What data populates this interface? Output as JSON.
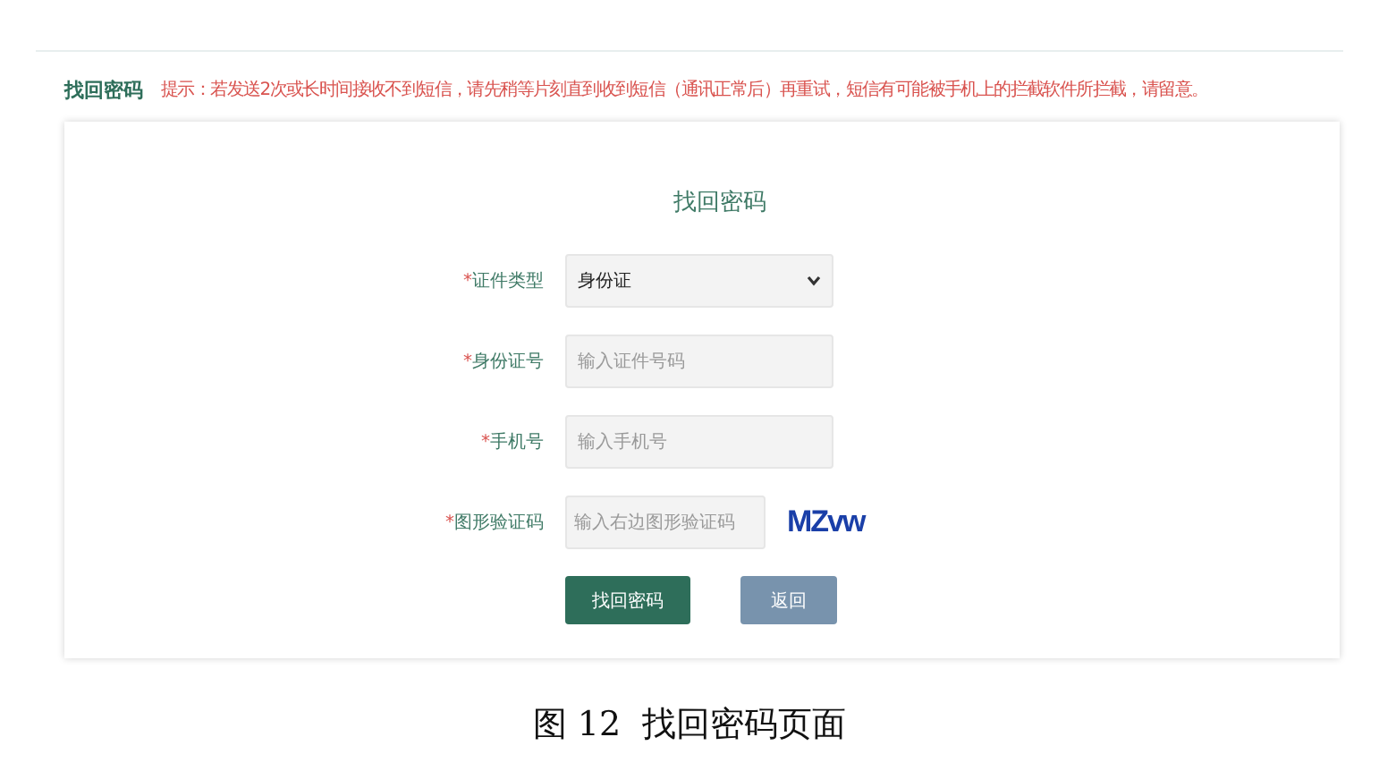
{
  "header": {
    "title": "找回密码",
    "hint": "提示：若发送2次或长时间接收不到短信，请先稍等片刻直到收到短信（通讯正常后）再重试，短信有可能被手机上的拦截软件所拦截，请留意。"
  },
  "form": {
    "title": "找回密码",
    "fields": [
      {
        "kind": "select",
        "mark": "*",
        "label": "证件类型",
        "value": "身份证"
      },
      {
        "kind": "input",
        "mark": "*",
        "label": "身份证号",
        "placeholder": "输入证件号码"
      },
      {
        "kind": "input",
        "mark": "*",
        "label": "手机号",
        "placeholder": "输入手机号"
      },
      {
        "kind": "captcha",
        "mark": "*",
        "label": "图形验证码",
        "placeholder": "输入右边图形验证码",
        "captcha": "MZvw"
      }
    ],
    "buttons": [
      {
        "kind": "primary",
        "label": "找回密码"
      },
      {
        "kind": "secondary",
        "label": "返回"
      }
    ]
  },
  "caption": "图 12  找回密码页面"
}
